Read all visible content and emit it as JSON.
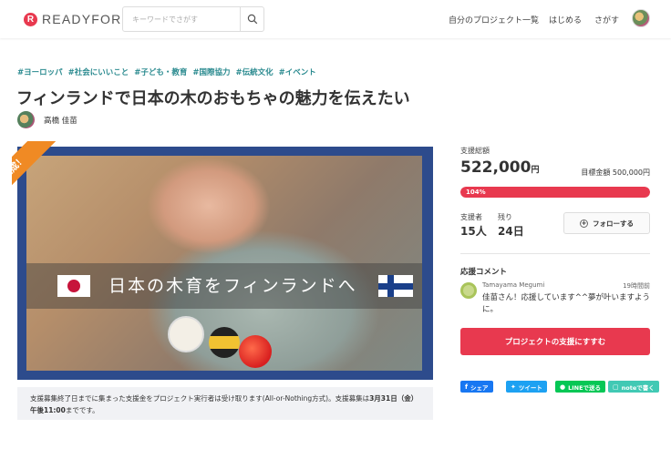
{
  "header": {
    "logo_mark": "R",
    "logo_text": "READYFOR",
    "search_placeholder": "キーワードでさがす",
    "nav": [
      "自分のプロジェクト一覧",
      "はじめる",
      "さがす"
    ]
  },
  "project": {
    "tags": [
      "#ヨーロッパ",
      "#社会にいいこと",
      "#子ども・教育",
      "#国際協力",
      "#伝統文化",
      "#イベント"
    ],
    "title": "フィンランドで日本の木のおもちゃの魅力を伝えたい",
    "owner": "高橋 佳苗",
    "image_banner": "日本の木育をフィンランドへ",
    "ribbon": "達成！",
    "note_prefix": "支援募集終了日までに集まった支援金をプロジェクト実行者は受け取ります(All-or-Nothing方式)。支援募集は",
    "note_deadline": "3月31日（金）午後11:00",
    "note_suffix": "までです。"
  },
  "stats": {
    "total_label": "支援総額",
    "total_amount": "522,000",
    "total_unit": "円",
    "goal_text": "目標金額 500,000円",
    "progress_label": "104%",
    "progress_fraction": 1.0,
    "supporters_label": "支援者",
    "supporters_value": "15人",
    "remaining_label": "残り",
    "remaining_value": "24日",
    "follow_label": "フォローする"
  },
  "comments": {
    "title": "応援コメント",
    "items": [
      {
        "user": "Tamayama Megumi",
        "time": "19時間前",
        "text": "佳苗さん！応援しています^^夢が叶いますように。"
      }
    ]
  },
  "support_button": "プロジェクトの支援にすすむ",
  "share": {
    "facebook": "シェア",
    "twitter": "ツイート",
    "line": "LINEで送る",
    "note": "noteで書く"
  },
  "colors": {
    "brand": "#e8394f",
    "tag": "#2a8a8f",
    "ribbon": "#f08a24",
    "media_frame": "#2d4b8c",
    "facebook": "#1877f2",
    "twitter": "#1da1f2",
    "line": "#06c755",
    "note": "#41c9b4"
  },
  "icons": [
    "search-icon",
    "plus-circle-icon",
    "facebook-icon",
    "twitter-icon",
    "line-icon",
    "note-icon"
  ]
}
